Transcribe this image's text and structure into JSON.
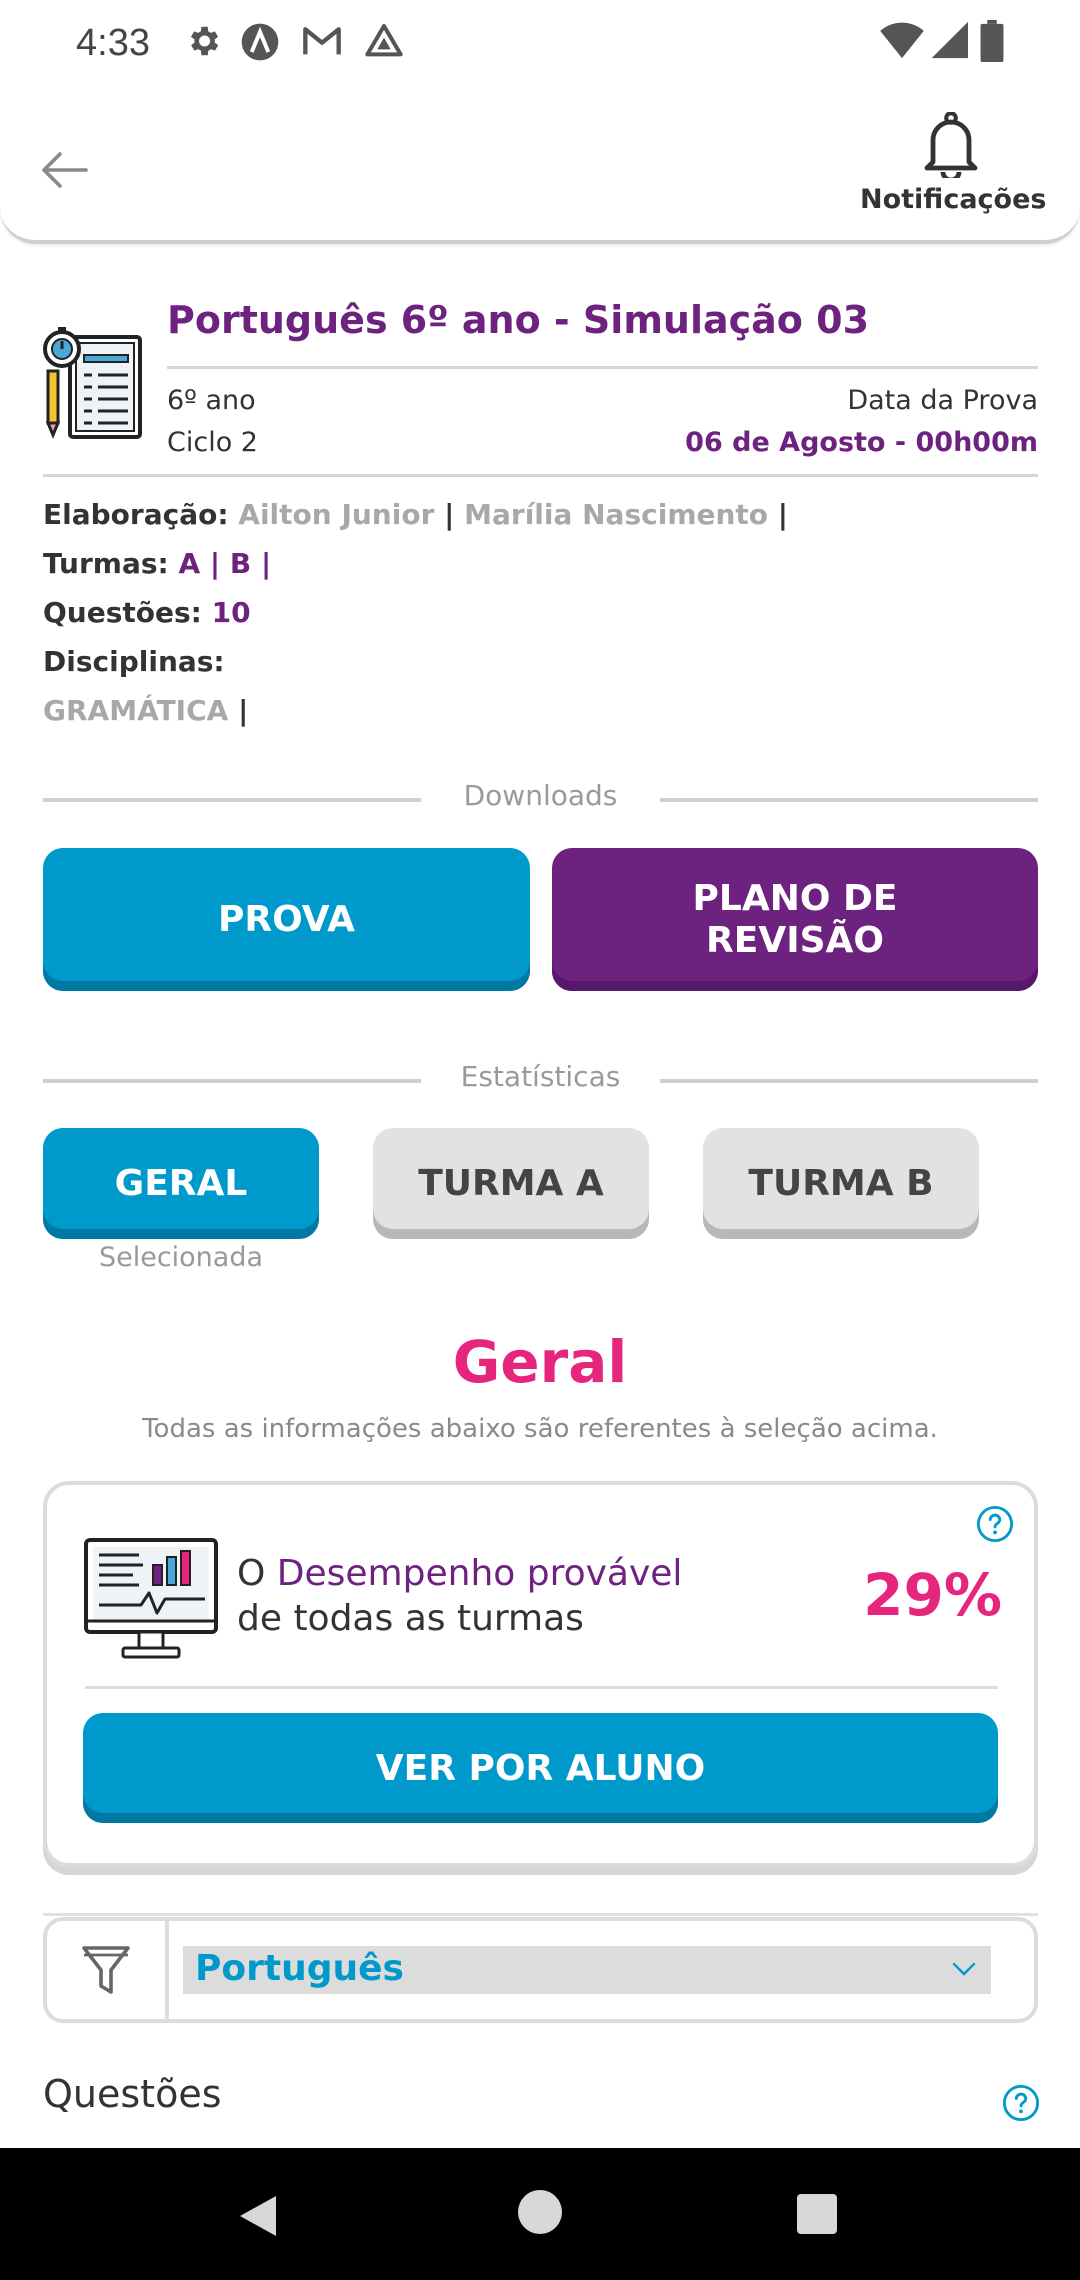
{
  "status_bar": {
    "time": "4:33",
    "icons": [
      "settings-icon",
      "app-a-icon",
      "gmail-icon",
      "drive-icon",
      "wifi-icon",
      "signal-icon",
      "battery-icon"
    ]
  },
  "header": {
    "back_icon": "arrow-left-icon",
    "notifications_label": "Notificações",
    "notifications_icon": "bell-icon"
  },
  "exam": {
    "icon": "exam-sheet-icon",
    "title": "Português 6º ano - Simulação 03",
    "grade": "6º ano",
    "cycle": "Ciclo 2",
    "date_label": "Data da Prova",
    "date_value": "06 de Agosto - 00h00m",
    "elaboracao_label": "Elaboração:",
    "elaboracao_names": [
      "Ailton Junior",
      "Marília Nascimento"
    ],
    "separator": "|",
    "turmas_label": "Turmas:",
    "turmas": [
      "A",
      "B"
    ],
    "questoes_label": "Questões:",
    "questoes_value": "10",
    "disciplinas_label": "Disciplinas:",
    "disciplinas": [
      "GRAMÁTICA"
    ]
  },
  "downloads": {
    "section_title": "Downloads",
    "prova_label": "PROVA",
    "plano_label_line1": "PLANO DE",
    "plano_label_line2": "REVISÃO"
  },
  "stats": {
    "section_title": "Estatísticas",
    "tabs": [
      {
        "label": "GERAL",
        "selected": true
      },
      {
        "label": "TURMA A",
        "selected": false
      },
      {
        "label": "TURMA B",
        "selected": false
      }
    ],
    "selected_label": "Selecionada",
    "title": "Geral",
    "subtitle": "Todas as informações abaixo são referentes à seleção acima."
  },
  "performance": {
    "prefix": "O ",
    "highlight": "Desempenho provável",
    "suffix": "de todas as turmas",
    "value": "29%",
    "button": "VER POR ALUNO",
    "icon": "monitor-chart-icon",
    "help_icon": "help-circle-icon"
  },
  "filter": {
    "icon": "funnel-icon",
    "selected": "Português",
    "chevron_icon": "chevron-down-icon"
  },
  "questoes_heading": "Questões",
  "colors": {
    "primary_blue": "#0099cc",
    "purple": "#6e2280",
    "pink": "#e6267d",
    "gray_text": "#a8a8a8"
  }
}
